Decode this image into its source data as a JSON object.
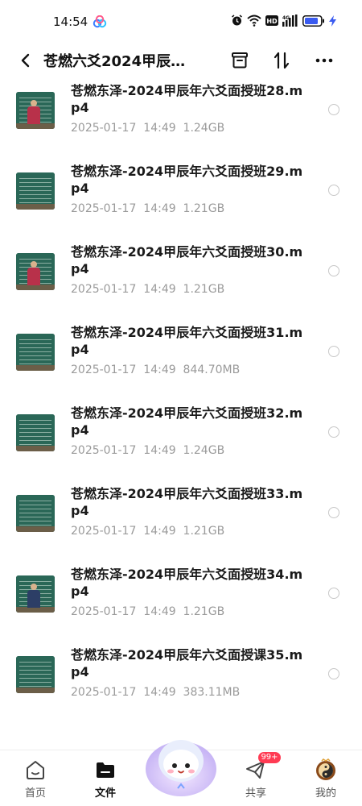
{
  "status_bar": {
    "time": "14:54",
    "app_icon": "baidu-netdisk-icon",
    "icons": [
      "alarm-icon",
      "wifi-icon",
      "hd-icon",
      "signal-4g-icon",
      "battery-icon",
      "charging-icon"
    ],
    "network": "4G"
  },
  "header": {
    "title": "苍燃六爻2024甲辰…",
    "back_icon": "chevron-left-icon",
    "actions": [
      "archive-icon",
      "sort-icon",
      "more-icon"
    ]
  },
  "files": [
    {
      "name": "苍燃东泽-2024甲辰年六爻面授班28.mp4",
      "date": "2025-01-17",
      "time": "14:49",
      "size": "1.24GB",
      "thumb": "teacher-red"
    },
    {
      "name": "苍燃东泽-2024甲辰年六爻面授班29.mp4",
      "date": "2025-01-17",
      "time": "14:49",
      "size": "1.21GB",
      "thumb": "board"
    },
    {
      "name": "苍燃东泽-2024甲辰年六爻面授班30.mp4",
      "date": "2025-01-17",
      "time": "14:49",
      "size": "1.21GB",
      "thumb": "teacher-red"
    },
    {
      "name": "苍燃东泽-2024甲辰年六爻面授班31.mp4",
      "date": "2025-01-17",
      "time": "14:49",
      "size": "844.70MB",
      "thumb": "board"
    },
    {
      "name": "苍燃东泽-2024甲辰年六爻面授班32.mp4",
      "date": "2025-01-17",
      "time": "14:49",
      "size": "1.24GB",
      "thumb": "board"
    },
    {
      "name": "苍燃东泽-2024甲辰年六爻面授班33.mp4",
      "date": "2025-01-17",
      "time": "14:49",
      "size": "1.21GB",
      "thumb": "board"
    },
    {
      "name": "苍燃东泽-2024甲辰年六爻面授班34.mp4",
      "date": "2025-01-17",
      "time": "14:49",
      "size": "1.21GB",
      "thumb": "teacher-dark"
    },
    {
      "name": "苍燃东泽-2024甲辰年六爻面授课35.mp4",
      "date": "2025-01-17",
      "time": "14:49",
      "size": "383.11MB",
      "thumb": "board"
    }
  ],
  "bottom_nav": {
    "tabs": [
      {
        "label": "首页",
        "icon": "home-icon",
        "active": false
      },
      {
        "label": "文件",
        "icon": "folder-icon",
        "active": true
      },
      {
        "label": "共享",
        "icon": "send-icon",
        "active": false,
        "badge": "99+"
      },
      {
        "label": "我的",
        "icon": "avatar-icon",
        "active": false
      }
    ],
    "center": "mascot-icon"
  },
  "colors": {
    "accent_badge": "#ff3b53",
    "meta_text": "#9a9a9a",
    "battery": "#3a5bf0"
  }
}
